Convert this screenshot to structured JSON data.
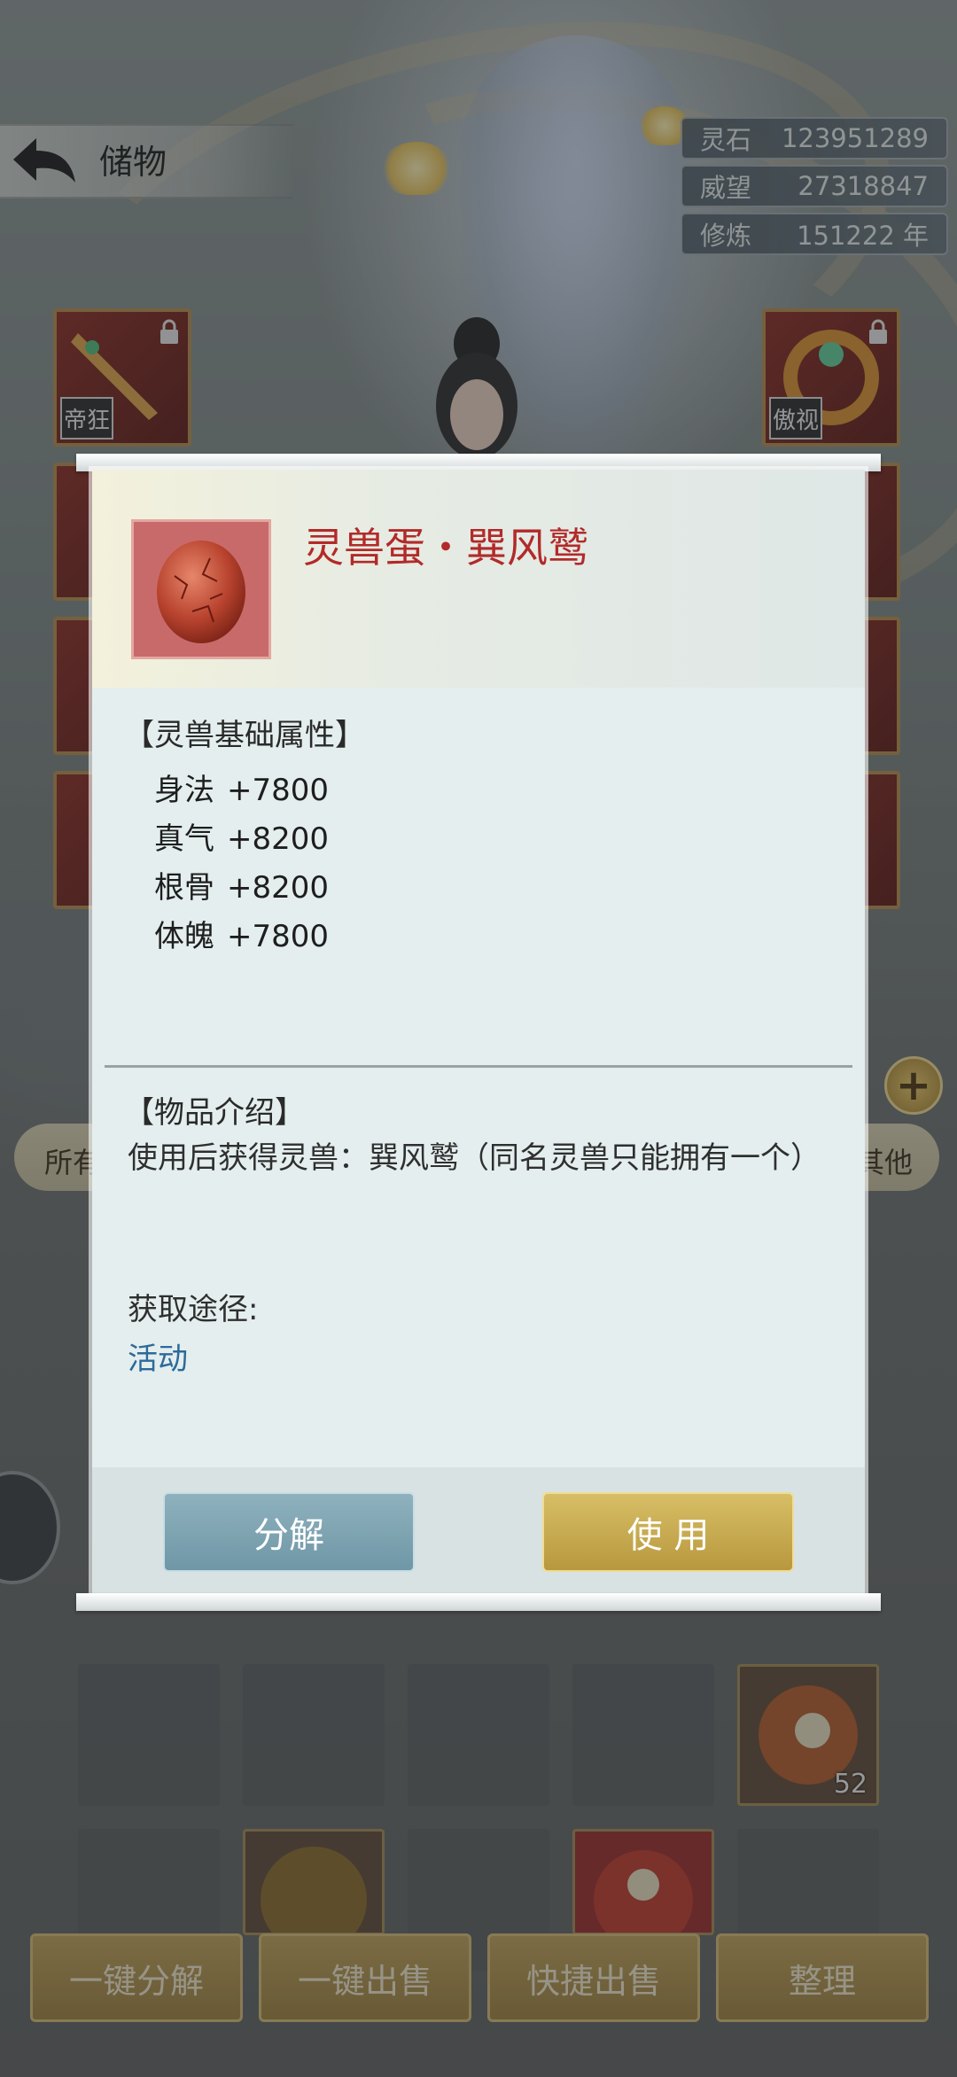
{
  "header": {
    "title": "储物"
  },
  "stats": [
    {
      "label": "灵石",
      "value": "123951289"
    },
    {
      "label": "威望",
      "value": "27318847"
    },
    {
      "label": "修炼",
      "value": "151222 年"
    }
  ],
  "equip_seals": [
    "帝狂",
    "傲视"
  ],
  "tabs": {
    "first": "所有",
    "last": "其他"
  },
  "inventory": {
    "stack_count": "52"
  },
  "bottom_buttons": [
    "一键分解",
    "一键出售",
    "快捷出售",
    "整理"
  ],
  "modal": {
    "item_name": "灵兽蛋・巽风鹫",
    "attr_title": "【灵兽基础属性】",
    "attributes": [
      {
        "name": "身法",
        "value": "+7800"
      },
      {
        "name": "真气",
        "value": "+8200"
      },
      {
        "name": "根骨",
        "value": "+8200"
      },
      {
        "name": "体魄",
        "value": "+7800"
      }
    ],
    "intro_title": "【物品介绍】",
    "intro_text": "使用后获得灵兽：巽风鹫（同名灵兽只能拥有一个）",
    "source_label": "获取途径:",
    "source_value": "活动",
    "decompose_label": "分解",
    "use_label": "使 用"
  },
  "colors": {
    "item_name": "#b22a2a",
    "source_link": "#2c6a9a",
    "use_button": "#c9ad52",
    "decompose_button": "#7fa4b2"
  }
}
